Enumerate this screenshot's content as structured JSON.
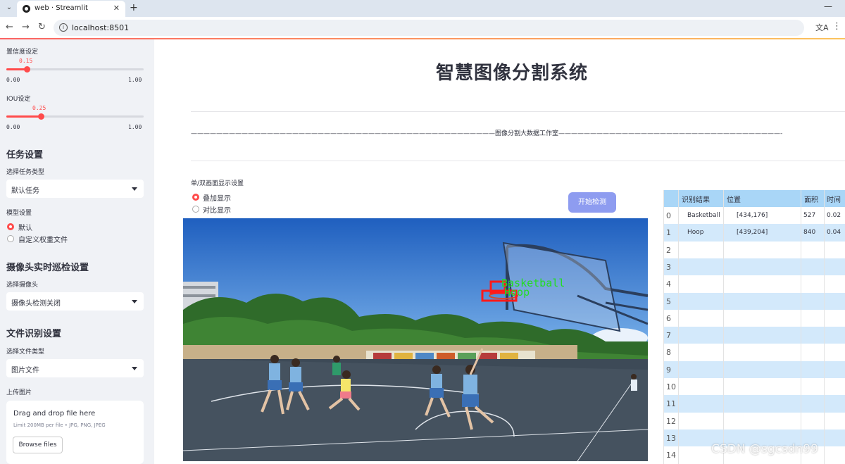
{
  "browser": {
    "tab_title": "web · Streamlit",
    "url": "localhost:8501"
  },
  "sidebar": {
    "confidence": {
      "label": "置信度设定",
      "value": "0.15",
      "min": "0.00",
      "max": "1.00",
      "fraction": 0.15
    },
    "iou": {
      "label": "IOU设定",
      "value": "0.25",
      "min": "0.00",
      "max": "1.00",
      "fraction": 0.25
    },
    "task": {
      "header": "任务设置",
      "select_label": "选择任务类型",
      "selected": "默认任务"
    },
    "model": {
      "label": "模型设置",
      "options": [
        "默认",
        "自定义权重文件"
      ],
      "selected_index": 0
    },
    "camera": {
      "header": "摄像头实时巡检设置",
      "select_label": "选择摄像头",
      "selected": "摄像头检测关闭"
    },
    "file": {
      "header": "文件识别设置",
      "select_label": "选择文件类型",
      "selected": "图片文件",
      "upload_label": "上传图片"
    },
    "uploader": {
      "drag_text": "Drag and drop file here",
      "limit_text": "Limit 200MB per file • JPG, PNG, JPEG",
      "browse_label": "Browse files"
    }
  },
  "main": {
    "title": "智慧图像分割系统",
    "subtitle_line": "————————————————————————————————————————————————图像分割大数据工作室———————————————————————————————————————————————————",
    "display_label": "单/双画面显示设置",
    "display_options": [
      "叠加显示",
      "对比显示"
    ],
    "display_selected_index": 0,
    "start_button": "开始检测",
    "detections": [
      {
        "label": "Basketball"
      },
      {
        "label": "Hoop"
      }
    ]
  },
  "results_table": {
    "columns": [
      "识别结果",
      "位置",
      "面积",
      "时间"
    ],
    "rows": [
      {
        "index": "0",
        "result": "Basketball",
        "position": "[434,176]",
        "area": "527",
        "time": "0.02"
      },
      {
        "index": "1",
        "result": "Hoop",
        "position": "[439,204]",
        "area": "840",
        "time": "0.04"
      },
      {
        "index": "2"
      },
      {
        "index": "3"
      },
      {
        "index": "4"
      },
      {
        "index": "5"
      },
      {
        "index": "6"
      },
      {
        "index": "7"
      },
      {
        "index": "8"
      },
      {
        "index": "9"
      },
      {
        "index": "10"
      },
      {
        "index": "11"
      },
      {
        "index": "12"
      },
      {
        "index": "13"
      },
      {
        "index": "14"
      }
    ]
  },
  "watermark": "CSDN @sgcsdn99",
  "colors": {
    "accent": "#ff4b4b",
    "button": "#8e9cf0",
    "table_header": "#a9d6f7",
    "table_alt": "#d3e9fb",
    "sidebar_bg": "#f0f2f6"
  }
}
